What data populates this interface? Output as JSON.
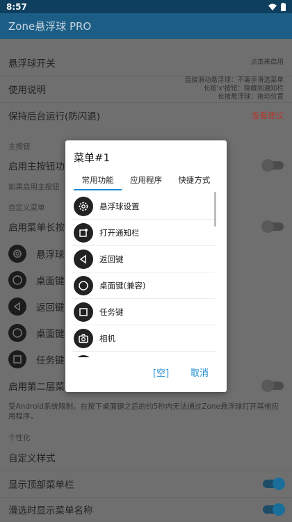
{
  "status": {
    "time": "8:57"
  },
  "app": {
    "title": "Zone悬浮球 PRO"
  },
  "rows": {
    "float_switch": {
      "label": "悬浮球开关",
      "hint": "点击来启用"
    },
    "usage": {
      "label": "使用说明",
      "hint_line1": "直接滑动悬浮球：不离手滑选菜单",
      "hint_line2": "长按'x'按钮：隐藏到通知栏",
      "hint_line3": "长按悬浮球：拖动位置"
    },
    "keep_alive": {
      "label": "保持后台运行(防闪退)",
      "hint": "查看建议"
    }
  },
  "sections": {
    "main_button": "主按钮",
    "custom_menu": "自定义菜单",
    "personal": "个性化"
  },
  "main_button": {
    "enable_label": "启用主按钮功能",
    "sub_note": "如果启用主按钮"
  },
  "custom_menu": {
    "long_press_label": "启用菜单长按",
    "items": [
      {
        "label": "悬浮球设",
        "icon": "gear-icon"
      },
      {
        "label": "桌面键(",
        "icon": "circle-icon"
      },
      {
        "label": "返回键",
        "icon": "back-triangle-icon"
      },
      {
        "label": "桌面键(",
        "icon": "circle-icon"
      },
      {
        "label": "任务键",
        "icon": "square-icon"
      }
    ],
    "second_layer_label": "启用第二层菜单",
    "note": "受Android系统限制，在按下桌面键之后的约5秒内无法通过Zone悬浮球打开其他应用程序。"
  },
  "personal": {
    "custom_style": "自定义样式",
    "show_top_menu": "显示顶部菜单栏",
    "show_menu_name": "滑选时显示菜单名称"
  },
  "dialog": {
    "title": "菜单#1",
    "tabs": [
      "常用功能",
      "应用程序",
      "快捷方式"
    ],
    "items": [
      {
        "label": "悬浮球设置",
        "icon": "gear-icon"
      },
      {
        "label": "打开通知栏",
        "icon": "notification-icon"
      },
      {
        "label": "返回键",
        "icon": "back-triangle-icon"
      },
      {
        "label": "桌面键(兼容)",
        "icon": "circle-icon"
      },
      {
        "label": "任务键",
        "icon": "square-icon"
      },
      {
        "label": "相机",
        "icon": "camera-icon"
      }
    ],
    "empty_button": "[空]",
    "cancel_button": "取消"
  },
  "colors": {
    "accent": "#1a8bd0",
    "appbar": "#1b5d85",
    "statusbar": "#0e3f5e",
    "warning": "#b03a2e"
  }
}
